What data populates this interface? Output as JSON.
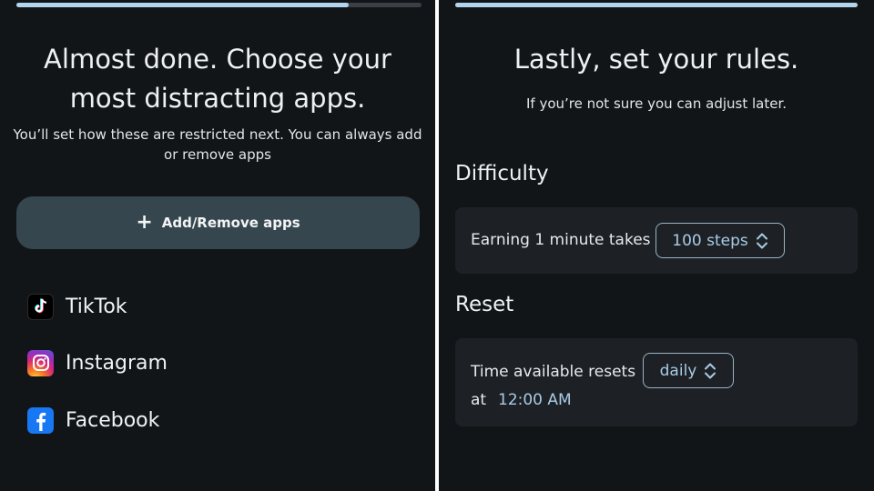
{
  "left_screen": {
    "progress": 0.82,
    "title_line1": "Almost done. Choose your",
    "title_line2": "most distracting apps.",
    "subtitle": "You’ll set how these are restricted next. You can always add or remove apps",
    "add_button": {
      "icon": "plus-icon",
      "label": "Add/Remove apps"
    },
    "apps": [
      {
        "name": "TikTok",
        "icon": "tiktok-icon"
      },
      {
        "name": "Instagram",
        "icon": "instagram-icon"
      },
      {
        "name": "Facebook",
        "icon": "facebook-icon"
      }
    ]
  },
  "right_screen": {
    "progress": 1.0,
    "title": "Lastly, set your rules.",
    "subtitle": "If you’re not sure you can adjust later.",
    "difficulty": {
      "heading": "Difficulty",
      "label": "Earning 1 minute takes",
      "value": "100 steps",
      "icon": "up-down-chevron-icon"
    },
    "reset": {
      "heading": "Reset",
      "label": "Time available resets",
      "value": "daily",
      "icon": "up-down-chevron-icon",
      "at_label": "at",
      "time": "12:00 AM"
    }
  },
  "colors": {
    "background": "#121518",
    "card": "#1d2125",
    "button": "#36464e",
    "accent": "#a9cbe6",
    "progress": "#b3d4ee"
  }
}
